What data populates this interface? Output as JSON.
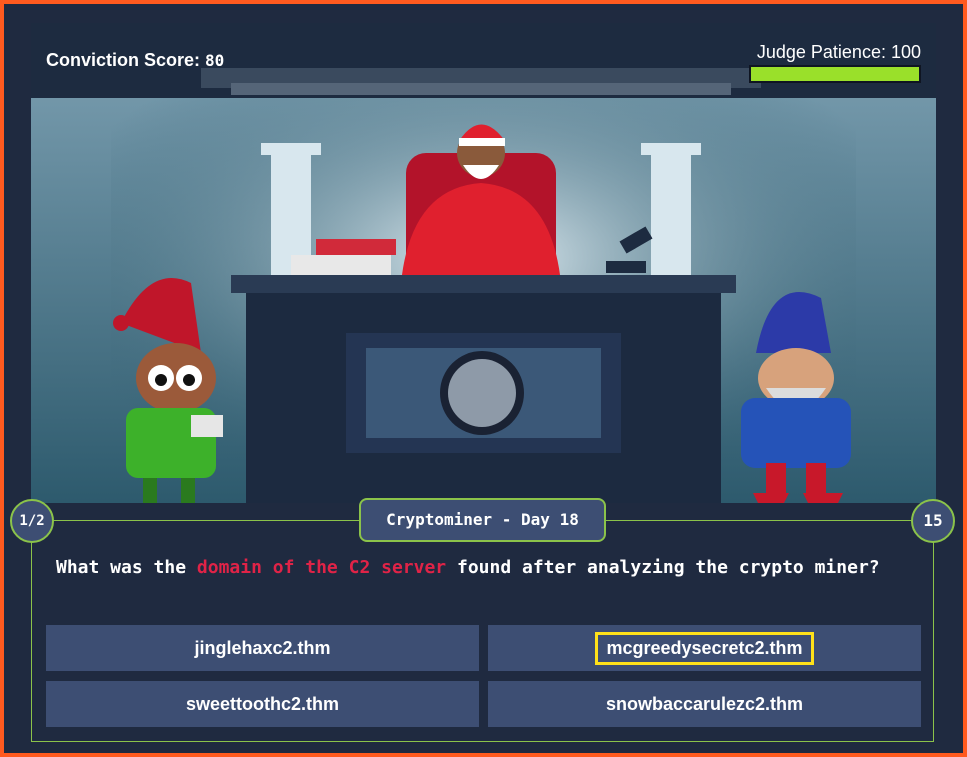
{
  "hud": {
    "conviction_label": "Conviction Score:",
    "conviction_value": "80",
    "patience_label": "Judge Patience: 100",
    "patience_fraction": 1.0,
    "patience_color": "#9ae02a"
  },
  "quiz": {
    "title": "Cryptominer - Day 18",
    "progress": "1/2",
    "timer": "15",
    "question_pre": "What was the ",
    "question_highlight": "domain of the C2 server",
    "question_post": " found after analyzing the crypto miner?",
    "highlight_color": "#e02347",
    "answers": [
      {
        "label": "jinglehaxc2.thm",
        "selected": false
      },
      {
        "label": "mcgreedysecretc2.thm",
        "selected": true
      },
      {
        "label": "sweettoothc2.thm",
        "selected": false
      },
      {
        "label": "snowbaccarulezc2.thm",
        "selected": false
      }
    ]
  },
  "theme": {
    "frame_border": "#ff5a1f",
    "panel_border": "#8bc34a",
    "button_bg": "#3d4e73",
    "selected_outline": "#ffe11a"
  }
}
